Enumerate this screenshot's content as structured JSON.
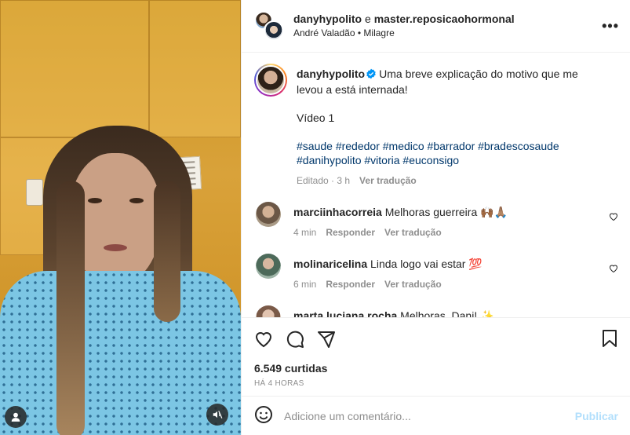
{
  "post": {
    "header": {
      "primary_user": "danyhypolito",
      "conjunction": "e",
      "collab_user": "master.reposicaohormonal",
      "audio_artist": "André Valadão",
      "audio_separator": "•",
      "audio_track": "Milagre"
    },
    "caption": {
      "username": "danyhypolito",
      "text_line1": "Uma breve explicação do motivo que me",
      "text_line2": "levou a está internada!",
      "text_line3": "Vídeo 1",
      "hashtags_line1": "#saude #rededor #medico #barrador #bradescosaude",
      "hashtags_line2": "#danihypolito #vitoria #euconsigo",
      "edited": "Editado · 3 h",
      "see_translation": "Ver tradução"
    },
    "comments": [
      {
        "username": "marciinhacorreia",
        "text": "Melhoras guerreira 🙌🏾🙏🏽",
        "time": "4 min",
        "reply": "Responder",
        "translate": "Ver tradução",
        "avatar_color": "#8b7a66"
      },
      {
        "username": "molinaricelina",
        "text": "Linda logo vai estar 💯",
        "time": "6 min",
        "reply": "Responder",
        "translate": "Ver tradução",
        "avatar_color": "#6f8a7a"
      },
      {
        "username": "marta.luciana.rocha",
        "text": "Melhoras, Dani! ✨",
        "time": "",
        "reply": "",
        "translate": "",
        "avatar_color": "#c7a28f"
      }
    ],
    "likes": "6.549 curtidas",
    "time_ago": "HÁ 4 HORAS",
    "composer": {
      "placeholder": "Adicione um comentário...",
      "publish": "Publicar"
    }
  },
  "colors": {
    "link_blue": "#00376b",
    "publish_disabled": "#b2dffc",
    "verified_blue": "#0095f6",
    "muted_text": "#8e8e8e"
  },
  "icons": [
    "more-icon",
    "verified-icon",
    "heart-icon",
    "comment-icon",
    "share-icon",
    "bookmark-icon",
    "emoji-icon",
    "user-icon",
    "mute-icon"
  ]
}
